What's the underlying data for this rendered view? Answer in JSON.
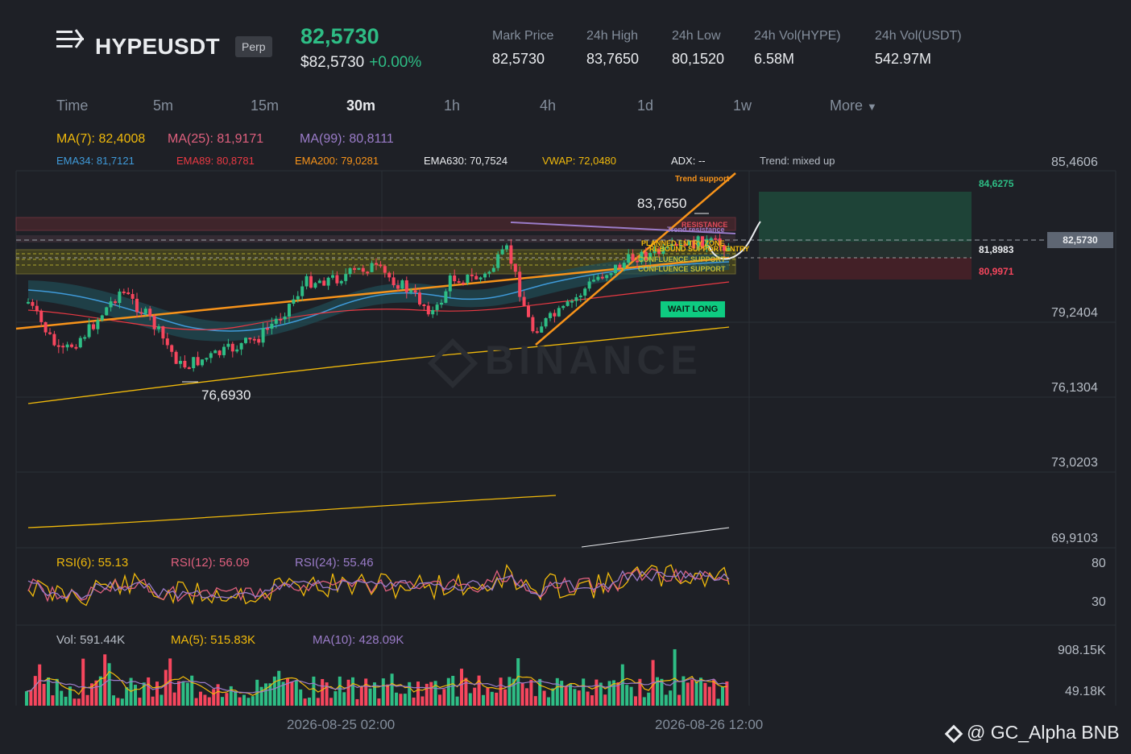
{
  "header": {
    "symbol": "HYPEUSDT",
    "badge": "Perp",
    "last_price": "82,5730",
    "last_price_usd": "$82,5730",
    "change": "+0.00%",
    "stats": [
      {
        "label": "Mark Price",
        "value": "82,5730"
      },
      {
        "label": "24h High",
        "value": "83,7650"
      },
      {
        "label": "24h Low",
        "value": "80,1520"
      },
      {
        "label": "24h Vol(HYPE)",
        "value": "6.58M"
      },
      {
        "label": "24h Vol(USDT)",
        "value": "542.97M"
      }
    ]
  },
  "timeframes": {
    "items": [
      "Time",
      "5m",
      "15m",
      "30m",
      "1h",
      "4h",
      "1d",
      "1w"
    ],
    "active": "30m",
    "more": "More"
  },
  "indicators": {
    "ma7": "MA(7): 82,4008",
    "ma25": "MA(25): 81,9171",
    "ma99": "MA(99): 80,8111",
    "ema34": "EMA34: 81,7121",
    "ema89": "EMA89: 80,8781",
    "ema200": "EMA200: 79,0281",
    "ema630": "EMA630: 70,7524",
    "vwap": "VWAP: 72,0480",
    "adx": "ADX: --",
    "trend": "Trend: mixed up"
  },
  "price_axis": [
    "85,4606",
    "79,2404",
    "76,1304",
    "73,0203",
    "69,9103"
  ],
  "price_tags": {
    "current": "82,5730",
    "target": "84,6275",
    "entry": "81,8983",
    "stop": "80,9971"
  },
  "annotations": {
    "high": "83,7650",
    "low": "76,6930",
    "trend_support": "Trend support",
    "resistance": "RESISTANCE",
    "trend_resistance": "Trend resistance",
    "planned_entry": "PLANNED ENTRY ZONE",
    "rebound_entry": "REBOUND SUPPORT ENTRY",
    "confluence_1": "CONFLUENCE SUPPORT",
    "confluence_2": "CONFLUENCE SUPPORT",
    "signal": "WAIT LONG"
  },
  "watermark": "BINANCE",
  "rsi": {
    "rsi6": "RSI(6): 55.13",
    "rsi12": "RSI(12): 56.09",
    "rsi24": "RSI(24): 55.46",
    "axis": [
      "80",
      "30"
    ]
  },
  "volume": {
    "vol": "Vol: 591.44K",
    "ma5": "MA(5): 515.83K",
    "ma10": "MA(10): 428.09K",
    "axis": [
      "908.15K",
      "49.18K"
    ]
  },
  "time_axis": [
    "2026-08-25 02:00",
    "2026-08-26 12:00"
  ],
  "footer": {
    "handle": "@ GC_Alpha BNB"
  },
  "colors": {
    "up": "#2ebd85",
    "down": "#f6465d",
    "ma7": "#f0b90b",
    "ma25": "#e0607e",
    "ma99": "#9b7cc9",
    "ema34": "#3f9ad9",
    "ema89": "#ea3943",
    "ema200": "#f7931a"
  }
}
